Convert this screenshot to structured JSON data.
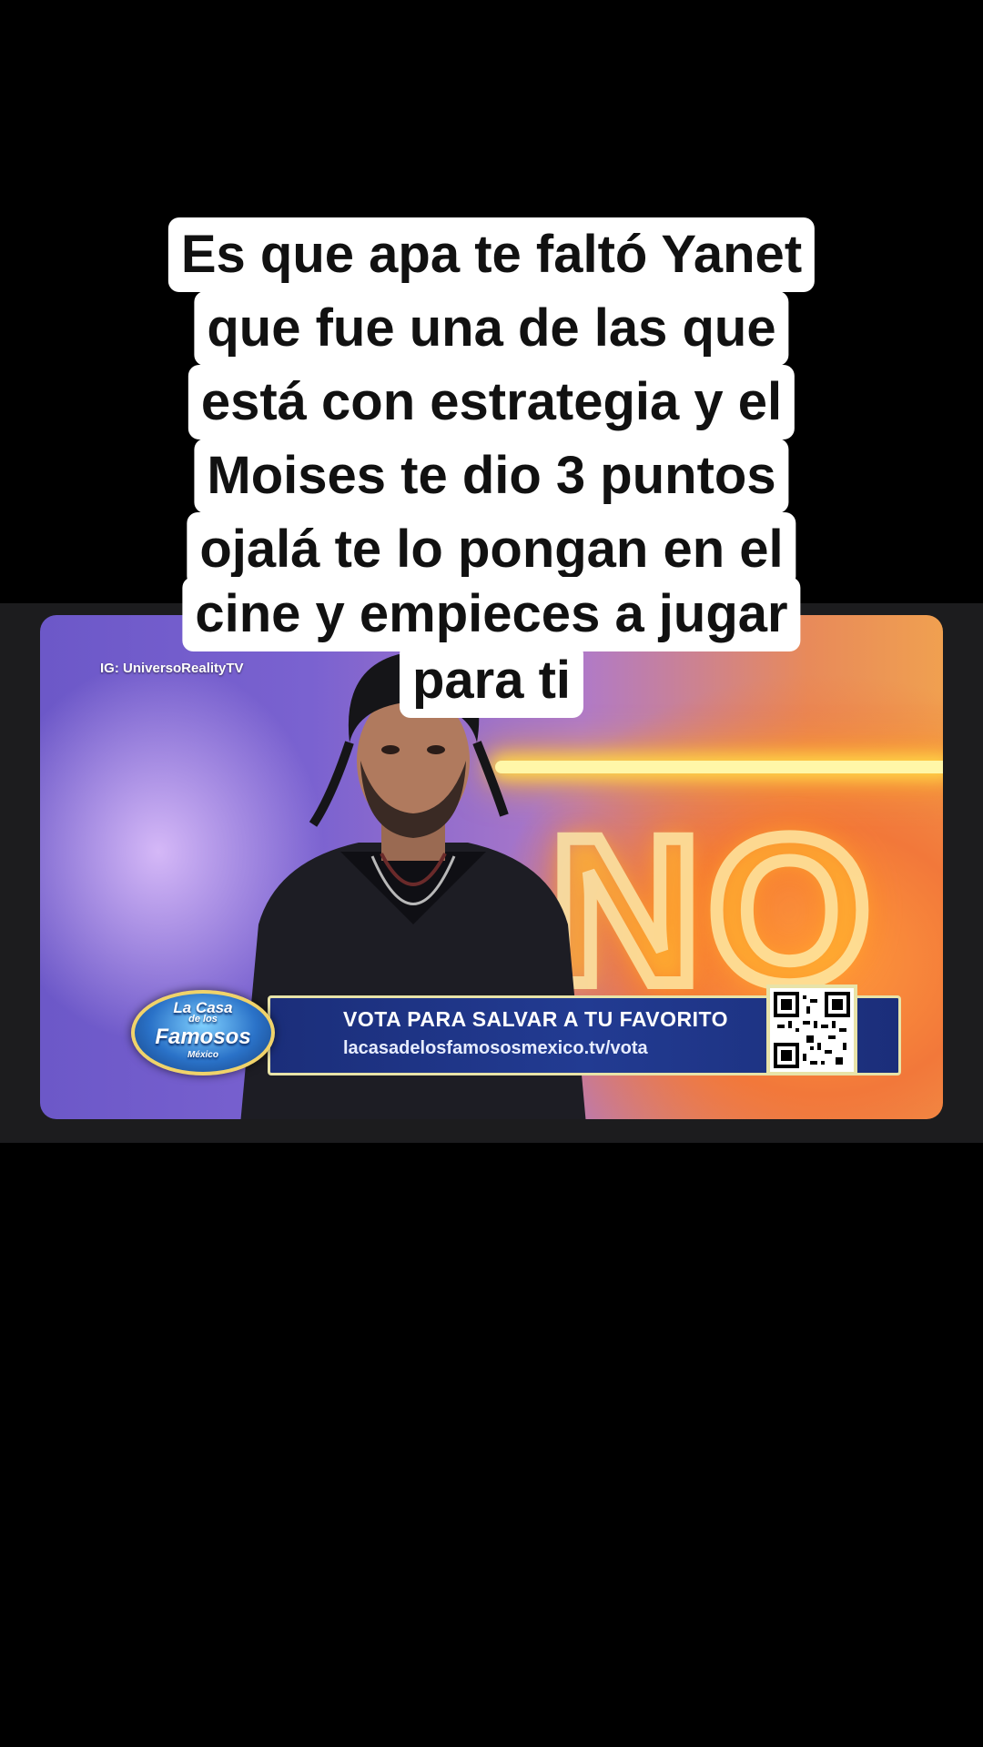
{
  "caption": {
    "lines": [
      "Es que apa te faltó Yanet",
      "que fue una de las que",
      "está  con estrategia y el",
      "Moises te dio 3 puntos",
      "ojalá te lo pongan en el",
      "cine y empieces a jugar",
      "para ti"
    ]
  },
  "video": {
    "watermark": "IG: UniversoRealityTV",
    "lower_third": {
      "title": "VOTA PARA SALVAR A TU FAVORITO",
      "url": "lacasadelosfamososmexico.tv/vota"
    },
    "logo": {
      "line1": "La Casa",
      "line2": "de los",
      "line3": "Famosos",
      "line4": "México"
    }
  },
  "colors": {
    "background": "#000000",
    "band": "#1c1c1e",
    "lower_third": "#1b2e7a",
    "lower_third_border": "#e8e3a8",
    "caption_bg": "#ffffff",
    "caption_text": "#111111"
  }
}
